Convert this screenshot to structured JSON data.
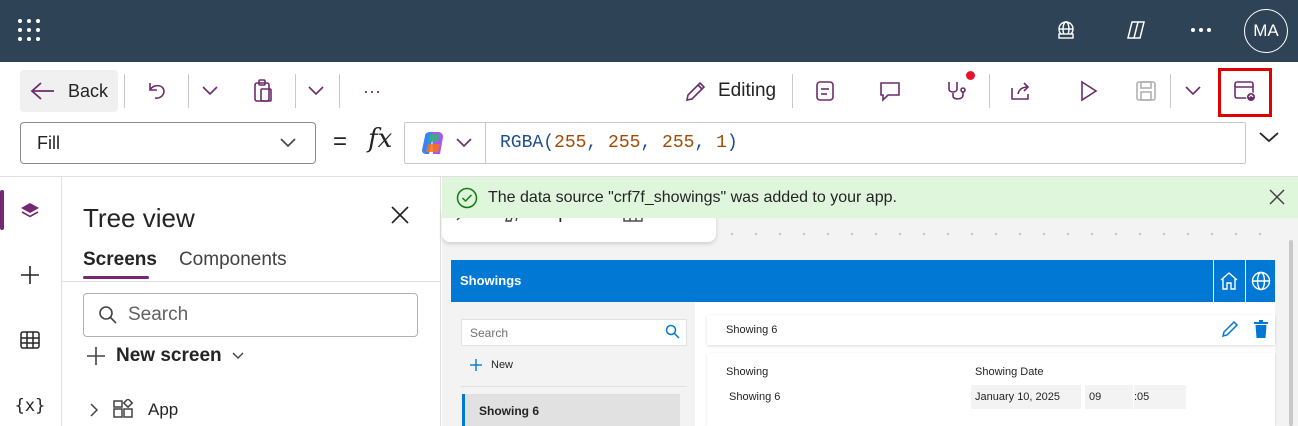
{
  "topbar": {
    "avatar_initials": "MA",
    "icons": [
      "app-launcher-icon",
      "environment-globe-icon",
      "copilot-icon",
      "more-icon"
    ],
    "background": "#2f4356"
  },
  "command_bar": {
    "back_label": "Back",
    "more_label": "···",
    "editing_label": "Editing",
    "accent": "#6b2c6b",
    "highlight_color": "#e00000"
  },
  "formula_bar": {
    "property": "Fill",
    "equals": "=",
    "fx": "fx",
    "formula": {
      "fn": "RGBA(",
      "r": "255",
      "c1": ", ",
      "g": "255",
      "c2": ", ",
      "b": "255",
      "c3": ", ",
      "a": "1",
      "close": ")"
    }
  },
  "tree_view": {
    "title": "Tree view",
    "tabs": [
      "Screens",
      "Components"
    ],
    "search_placeholder": "Search",
    "new_screen_label": "New screen",
    "items": [
      {
        "label": "App"
      }
    ]
  },
  "canvas": {
    "notification": "The data source \"crf7f_showings\" was added to your app.",
    "floating_toolbar": [
      "Copilot",
      "Data"
    ]
  },
  "app_preview": {
    "header_title": "Showings",
    "search_placeholder": "Search",
    "new_label": "New",
    "selected_item": "Showing 6",
    "detail_title": "Showing 6",
    "fields": {
      "showing_label": "Showing",
      "showing_value": "Showing 6",
      "date_label": "Showing Date",
      "date_value": "January 10, 2025",
      "hour": "09",
      "minute": ":05"
    },
    "accent": "#0078d4"
  }
}
